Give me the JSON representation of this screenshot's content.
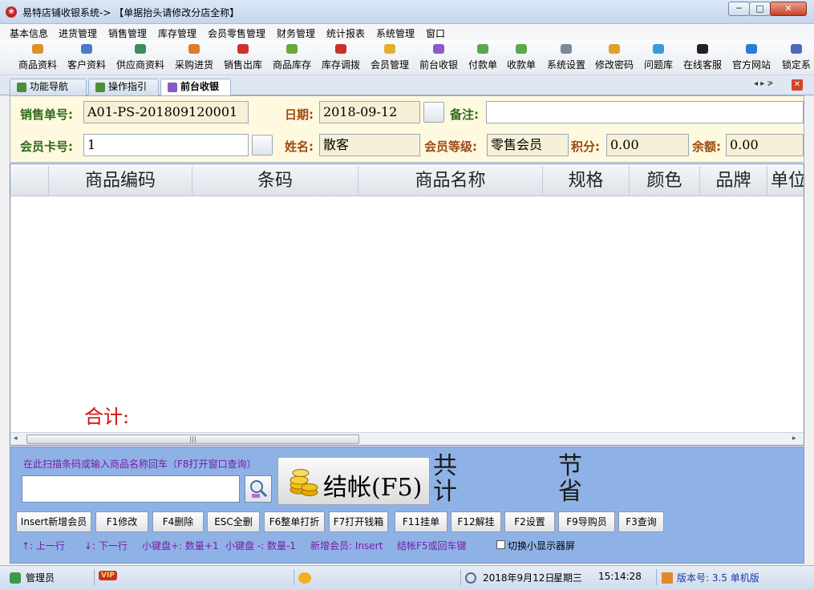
{
  "window": {
    "title": "易特店铺收银系统-> 【单据抬头请修改分店全称】",
    "controls": {
      "minimize": "─",
      "maximize": "□",
      "close": "✕"
    }
  },
  "menu": [
    "基本信息",
    "进货管理",
    "销售管理",
    "库存管理",
    "会员零售管理",
    "财务管理",
    "统计报表",
    "系统管理",
    "窗口"
  ],
  "toolbar": [
    {
      "label": "商品资料",
      "icon": "goods-icon",
      "color": "#e0902a"
    },
    {
      "label": "客户资料",
      "icon": "customer-icon",
      "color": "#4a7bc8"
    },
    {
      "label": "供应商资料",
      "icon": "supplier-icon",
      "color": "#3a8f5a"
    },
    {
      "label": "采购进货",
      "icon": "truck-icon",
      "color": "#e07a2a"
    },
    {
      "label": "销售出库",
      "icon": "basket-icon",
      "color": "#d0302a"
    },
    {
      "label": "商品库存",
      "icon": "box-icon",
      "color": "#6aa83a"
    },
    {
      "label": "库存调拨",
      "icon": "transfer-icon",
      "color": "#c8302a"
    },
    {
      "label": "会员管理",
      "icon": "member-icon",
      "color": "#e0b02a"
    },
    {
      "label": "前台收银",
      "icon": "cashier-icon",
      "color": "#8a5ac8"
    },
    {
      "label": "付款单",
      "icon": "payment-icon",
      "color": "#5aa84a"
    },
    {
      "label": "收款单",
      "icon": "receipt-icon",
      "color": "#5aa84a"
    },
    {
      "label": "系统设置",
      "icon": "settings-icon",
      "color": "#7a8a9a"
    },
    {
      "label": "修改密码",
      "icon": "key-icon",
      "color": "#e0a02a"
    },
    {
      "label": "问题库",
      "icon": "question-icon",
      "color": "#3a9ae0"
    },
    {
      "label": "在线客服",
      "icon": "qq-icon",
      "color": "#222222"
    },
    {
      "label": "官方网站",
      "icon": "ie-icon",
      "color": "#2a7ad8"
    },
    {
      "label": "锁定系",
      "icon": "lock-icon",
      "color": "#4a6ab8"
    }
  ],
  "tabs": [
    {
      "label": "功能导航"
    },
    {
      "label": "操作指引"
    },
    {
      "label": "前台收银"
    }
  ],
  "tab_controls": "◂ ▸ ≯",
  "form": {
    "order_no_label": "销售单号:",
    "order_no": "A01-PS-201809120001",
    "date_label": "日期:",
    "date": "2018-09-12",
    "note_label": "备注:",
    "note": "",
    "card_label": "会员卡号:",
    "card": "1",
    "name_label": "姓名:",
    "name": "散客",
    "level_label": "会员等级:",
    "level": "零售会员",
    "points_label": "积分:",
    "points": "0.00",
    "balance_label": "余额:",
    "balance": "0.00"
  },
  "grid": {
    "columns": [
      "商品编码",
      "条码",
      "商品名称",
      "规格",
      "颜色",
      "品牌",
      "单位"
    ],
    "rows": [],
    "total_label": "合计:",
    "scroll_grip": "|||"
  },
  "panel": {
    "scan_hint": "在此扫描条码或输入商品名称回车（F8打开窗口查询）",
    "scan_value": "",
    "checkout_label": "结帐(F5)",
    "sum_label": "共计",
    "save_label": "节省",
    "fkeys": [
      "Insert新增会员",
      "F1修改",
      "F4删除",
      "ESC全删",
      "F6整单打折",
      "F7打开钱箱",
      "F11挂单",
      "F12解挂",
      "F2设置",
      "F9导购员",
      "F3查询"
    ],
    "hints": [
      "↑: 上一行",
      "↓: 下一行",
      "小键盘+: 数量+1",
      "小键盘 -: 数量-1",
      "新增会员: Insert",
      "结帐F5或回车键"
    ],
    "toggle_label": "切换小显示器屏",
    "toggle_checked": false
  },
  "status": {
    "user": "管理员",
    "vip_badge": "VIP",
    "date": "2018年9月12日",
    "weekday": "星期三",
    "time": "15:14:28",
    "version": "版本号: 3.5 单机版"
  }
}
